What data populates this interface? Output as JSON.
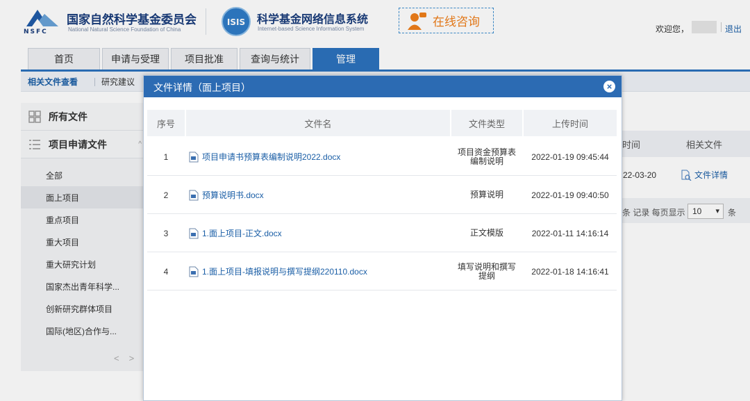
{
  "header": {
    "logo_text": "NSFC",
    "org_name_cn": "国家自然科学基金委员会",
    "org_name_en": "National Natural Science Foundation of China",
    "system_logo_text": "ISIS",
    "system_name_cn": "科学基金网络信息系统",
    "system_name_en": "Internet-based Science Information System",
    "consult_label": "在线咨询",
    "welcome": "欢迎您，",
    "logout": "退出"
  },
  "nav": {
    "tabs": [
      {
        "label": "首页"
      },
      {
        "label": "申请与受理"
      },
      {
        "label": "项目批准"
      },
      {
        "label": "查询与统计"
      },
      {
        "label": "管理"
      }
    ],
    "active_index": 4
  },
  "subnav": {
    "active": "相关文件查看",
    "item": "研究建议"
  },
  "sidebar": {
    "all_files": "所有文件",
    "project_files": "项目申请文件",
    "items": [
      {
        "label": "全部"
      },
      {
        "label": "面上项目"
      },
      {
        "label": "重点项目"
      },
      {
        "label": "重大项目"
      },
      {
        "label": "重大研究计划"
      },
      {
        "label": "国家杰出青年科学..."
      },
      {
        "label": "创新研究群体项目"
      },
      {
        "label": "国际(地区)合作与..."
      }
    ],
    "selected_index": 1,
    "pager_prev": "<",
    "pager_next": ">"
  },
  "background_table": {
    "col_time_partial": "时间",
    "col_related": "相关文件",
    "row_date_partial": "22-03-20",
    "row_link": "文件详情",
    "records_partial": "条 记录 每页显示",
    "page_size": "10",
    "page_size_suffix": "条"
  },
  "modal": {
    "title": "文件详情（面上项目）",
    "close_icon": "×",
    "columns": [
      "序号",
      "文件名",
      "文件类型",
      "上传时间"
    ],
    "rows": [
      {
        "no": "1",
        "file_name": "项目申请书预算表编制说明2022.docx",
        "type_line1": "项目资金预算表",
        "type_line2": "编制说明",
        "uploaded": "2022-01-19 09:45:44"
      },
      {
        "no": "2",
        "file_name": "预算说明书.docx",
        "type_line1": "预算说明",
        "type_line2": "",
        "uploaded": "2022-01-19 09:40:50"
      },
      {
        "no": "3",
        "file_name": "1.面上项目-正文.docx",
        "type_line1": "正文模版",
        "type_line2": "",
        "uploaded": "2022-01-11 14:16:14"
      },
      {
        "no": "4",
        "file_name": "1.面上项目-填报说明与撰写提纲220110.docx",
        "type_line1": "填写说明和撰写",
        "type_line2": "提纲",
        "uploaded": "2022-01-18 14:16:41"
      }
    ]
  },
  "colors": {
    "primary_blue": "#2c72be",
    "modal_header": "#2c6bb3",
    "link": "#1a5ea6",
    "accent_orange": "#f07f1a"
  }
}
